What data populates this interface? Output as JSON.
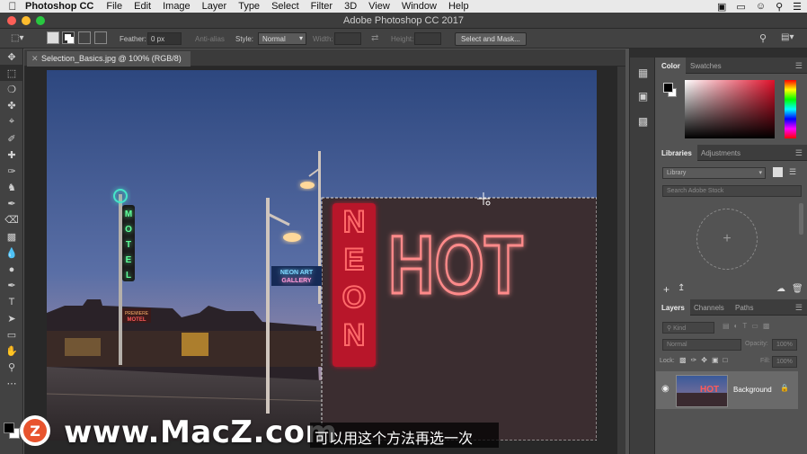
{
  "menubar": {
    "app_name": "Photoshop CC",
    "items": [
      "File",
      "Edit",
      "Image",
      "Layer",
      "Type",
      "Select",
      "Filter",
      "3D",
      "View",
      "Window",
      "Help"
    ]
  },
  "window": {
    "title": "Adobe Photoshop CC 2017"
  },
  "options": {
    "feather_label": "Feather:",
    "feather_value": "0 px",
    "anti_alias_label": "Anti-alias",
    "style_label": "Style:",
    "style_value": "Normal",
    "width_label": "Width:",
    "height_label": "Height:",
    "select_mask_label": "Select and Mask..."
  },
  "document": {
    "tab_title": "Selection_Basics.jpg @ 100% (RGB/8)"
  },
  "photo": {
    "sign_main": "HOT",
    "sign_vertical": "NEON",
    "motel_sign": "MOTEL",
    "neon_art_line1": "NEON ART",
    "neon_art_line2": "GALLERY",
    "premiere_line1": "PREMIERE",
    "premiere_line2": "MOTEL"
  },
  "panels": {
    "color_tab": "Color",
    "swatches_tab": "Swatches",
    "libraries_tab": "Libraries",
    "adjustments_tab": "Adjustments",
    "library_select": "Library",
    "search_placeholder": "Search Adobe Stock",
    "layers_tab": "Layers",
    "channels_tab": "Channels",
    "paths_tab": "Paths",
    "kind_filter": "Kind",
    "blend_mode": "Normal",
    "opacity_label": "Opacity:",
    "opacity_value": "100%",
    "lock_label": "Lock:",
    "fill_label": "Fill:",
    "fill_value": "100%",
    "layer_name": "Background"
  },
  "colors": {
    "foreground": "#000000",
    "background": "#ffffff",
    "neon_red": "#ff3a3a",
    "neon_pink": "#ff6f6f",
    "sky_top": "#2f4a86"
  },
  "watermark": {
    "text": "www.MacZ.com",
    "logo_letter": "Z"
  },
  "subtitle": "可以用这个方法再选一次"
}
